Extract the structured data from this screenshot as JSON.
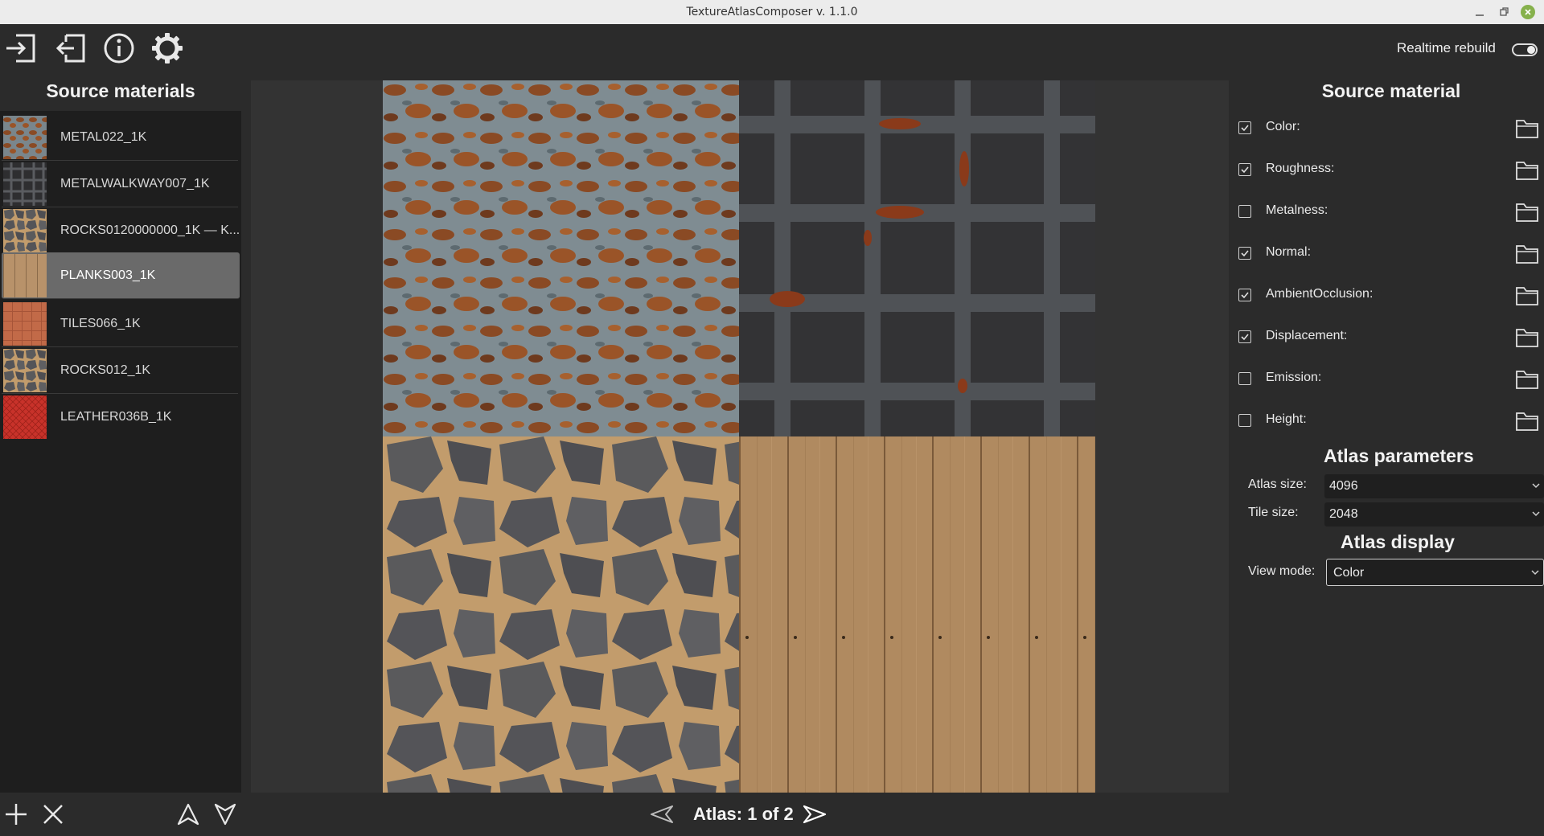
{
  "window": {
    "title": "TextureAtlasComposer v. 1.1.0"
  },
  "toolbar": {
    "icons": [
      "import-icon",
      "export-icon",
      "info-icon",
      "settings-gear-icon"
    ],
    "realtime_label": "Realtime rebuild",
    "realtime_on": true
  },
  "left_panel": {
    "title": "Source materials",
    "items": [
      {
        "label": "METAL022_1K",
        "thumb": "rusty-metal"
      },
      {
        "label": "METALWALKWAY007_1K",
        "thumb": "metal-grate"
      },
      {
        "label": "ROCKS0120000000_1K — K...",
        "thumb": "rocks"
      },
      {
        "label": "PLANKS003_1K",
        "thumb": "wood-planks",
        "selected": true
      },
      {
        "label": "TILES066_1K",
        "thumb": "orange-tiles"
      },
      {
        "label": "ROCKS012_1K",
        "thumb": "rocks"
      },
      {
        "label": "LEATHER036B_1K",
        "thumb": "red-leather"
      }
    ],
    "bottom_buttons": [
      "add-icon",
      "remove-icon",
      "move-up-icon",
      "move-down-icon"
    ]
  },
  "center": {
    "atlas_label": "Atlas: 1 of 2",
    "tiles": [
      "rusty-metal",
      "metal-grate",
      "rocks",
      "wood-planks"
    ]
  },
  "right_panel": {
    "title": "Source material",
    "channels": [
      {
        "label": "Color:",
        "checked": true
      },
      {
        "label": "Roughness:",
        "checked": true
      },
      {
        "label": "Metalness:",
        "checked": false
      },
      {
        "label": "Normal:",
        "checked": true
      },
      {
        "label": "AmbientOcclusion:",
        "checked": true
      },
      {
        "label": "Displacement:",
        "checked": true
      },
      {
        "label": "Emission:",
        "checked": false
      },
      {
        "label": "Height:",
        "checked": false
      }
    ],
    "atlas_parameters": {
      "title": "Atlas parameters",
      "atlas_size_label": "Atlas size:",
      "atlas_size_value": "4096",
      "tile_size_label": "Tile size:",
      "tile_size_value": "2048"
    },
    "atlas_display": {
      "title": "Atlas display",
      "view_mode_label": "View mode:",
      "view_mode_value": "Color"
    }
  },
  "colors": {
    "background": "#2b2b2b",
    "panel": "#1e1e1e",
    "selected": "#6a6a6a",
    "viewport": "#333333"
  }
}
